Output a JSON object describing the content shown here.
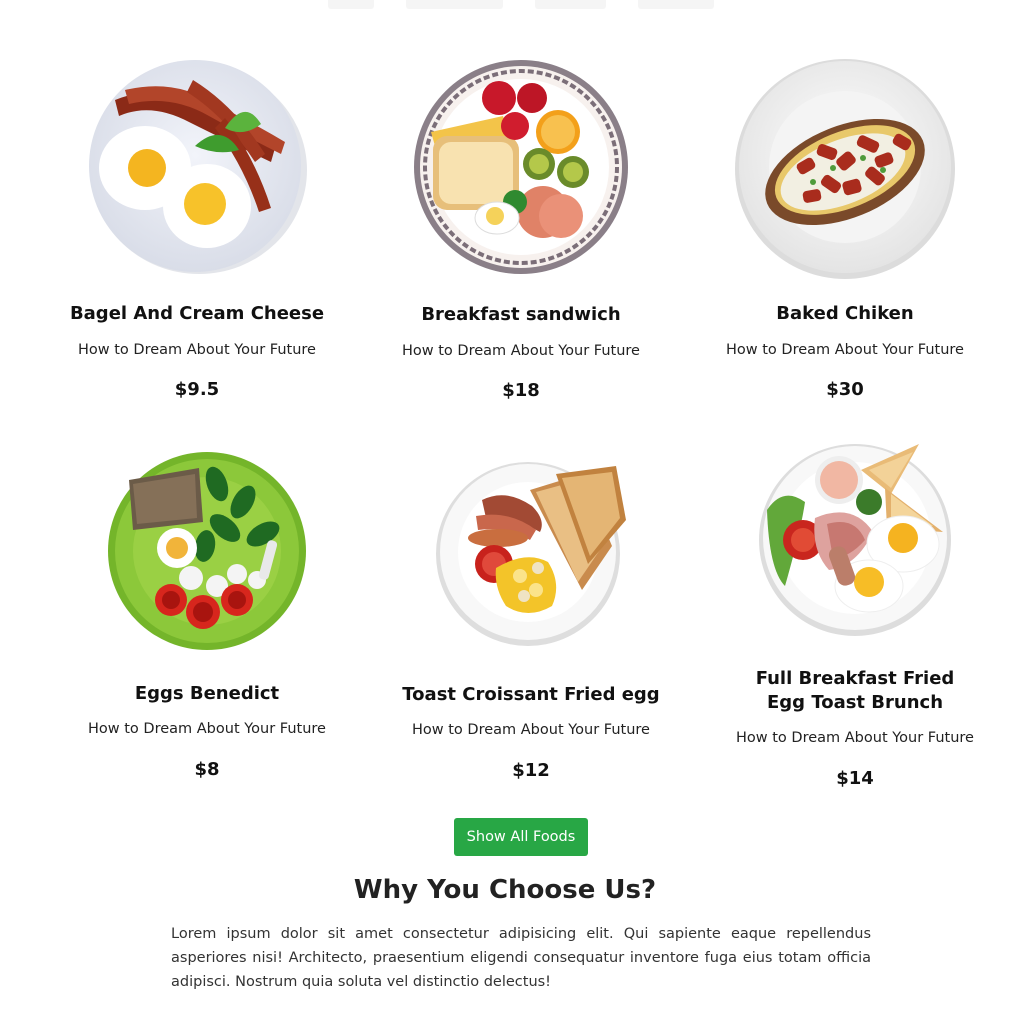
{
  "foods": [
    {
      "name": "Bagel And Cream Cheese",
      "description": "How to Dream About Your Future",
      "price": "$9.5"
    },
    {
      "name": "Breakfast sandwich",
      "description": "How to Dream About Your Future",
      "price": "$18"
    },
    {
      "name": "Baked Chiken",
      "description": "How to Dream About Your Future",
      "price": "$30"
    },
    {
      "name": "Eggs Benedict",
      "description": "How to Dream About Your Future",
      "price": "$8"
    },
    {
      "name": "Toast Croissant Fried egg",
      "description": "How to Dream About Your Future",
      "price": "$12"
    },
    {
      "name": "Full Breakfast Fried Egg Toast Brunch",
      "description": "How to Dream About Your Future",
      "price": "$14"
    }
  ],
  "show_all_button": "Show All Foods",
  "why_section": {
    "title": "Why You Choose Us?",
    "text": "Lorem ipsum dolor sit amet consectetur adipisicing elit. Qui sapiente eaque repellendus asperiores nisi! Architecto, praesentium eligendi consequatur inventore fuga eius totam officia adipisci. Nostrum quia soluta vel distinctio delectus!"
  },
  "colors": {
    "accent": "#28a745"
  }
}
